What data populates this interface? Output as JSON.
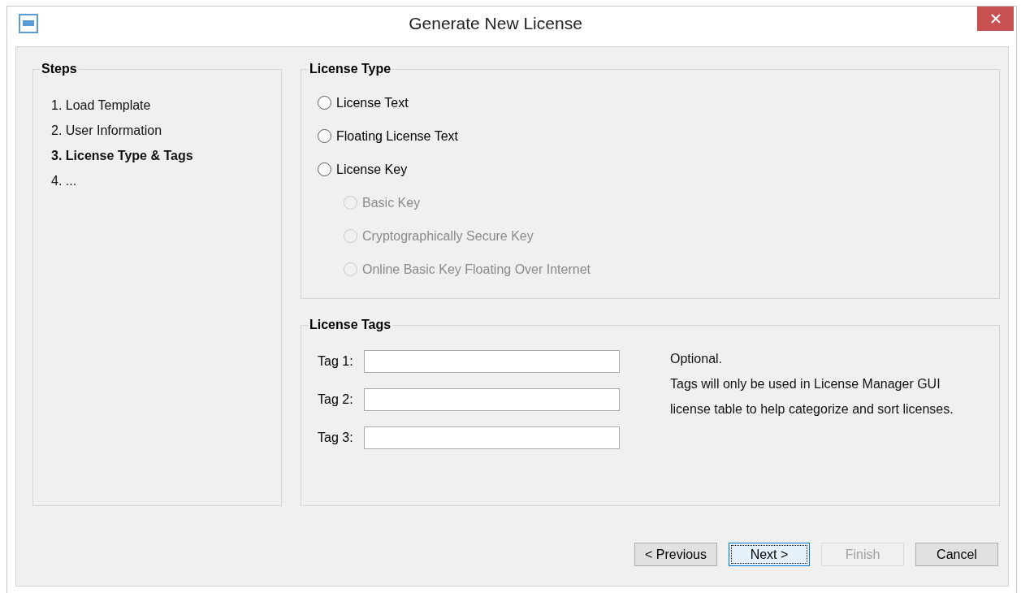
{
  "window": {
    "title": "Generate New License"
  },
  "steps": {
    "title": "Steps",
    "items": [
      {
        "label": "1. Load Template",
        "selected": false
      },
      {
        "label": "2. User Information",
        "selected": false
      },
      {
        "label": "3. License Type & Tags",
        "selected": true
      },
      {
        "label": "4. ...",
        "selected": false
      }
    ]
  },
  "license_type": {
    "title": "License Type",
    "options": [
      {
        "label": "License Text",
        "selected": false,
        "disabled": false
      },
      {
        "label": "Floating License Text",
        "selected": false,
        "disabled": false
      },
      {
        "label": "License Key",
        "selected": false,
        "disabled": false,
        "children": [
          {
            "label": "Basic Key",
            "selected": false,
            "disabled": true
          },
          {
            "label": "Cryptographically Secure Key",
            "selected": false,
            "disabled": true
          },
          {
            "label": "Online Basic Key Floating Over Internet",
            "selected": false,
            "disabled": true
          }
        ]
      }
    ]
  },
  "license_tags": {
    "title": "License Tags",
    "fields": [
      {
        "label": "Tag 1:"
      },
      {
        "label": "Tag 2:"
      },
      {
        "label": "Tag 3:"
      }
    ],
    "help": [
      "Optional.",
      "Tags will only be used in License Manager GUI",
      "license table to help categorize and sort licenses."
    ]
  },
  "buttons": [
    {
      "label": "< Previous",
      "disabled": false,
      "focused": false
    },
    {
      "label": "Next >",
      "disabled": false,
      "focused": true
    },
    {
      "label": "Finish",
      "disabled": true,
      "focused": false
    },
    {
      "label": "Cancel",
      "disabled": false,
      "focused": false
    }
  ]
}
